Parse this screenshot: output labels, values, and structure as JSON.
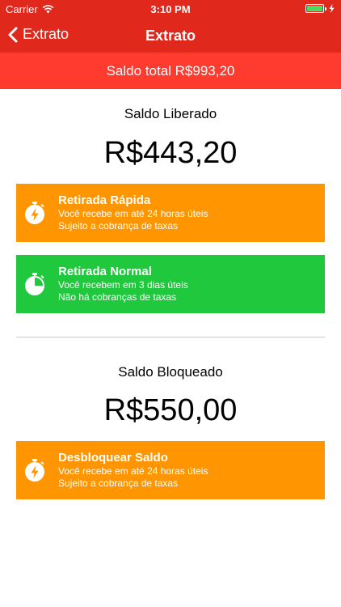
{
  "status_bar": {
    "carrier": "Carrier",
    "time": "3:10 PM"
  },
  "nav": {
    "back_label": "Extrato",
    "title": "Extrato"
  },
  "total": {
    "text": "Saldo total R$993,20"
  },
  "released": {
    "label": "Saldo Liberado",
    "amount": "R$443,20",
    "actions": [
      {
        "title": "Retirada Rápida",
        "line1": "Você recebe em até 24 horas úteis",
        "line2": "Sujeito a cobrança de taxas",
        "icon": "stopwatch-bolt-icon",
        "color": "#ff9500"
      },
      {
        "title": "Retirada Normal",
        "line1": "Você recebem em 3 dias úteis",
        "line2": "Não há cobranças de taxas",
        "icon": "stopwatch-icon",
        "color": "#1fc83c"
      }
    ]
  },
  "blocked": {
    "label": "Saldo Bloqueado",
    "amount": "R$550,00",
    "actions": [
      {
        "title": "Desbloquear Saldo",
        "line1": "Você recebe em até 24 horas úteis",
        "line2": "Sujeito a cobrança de taxas",
        "icon": "stopwatch-bolt-icon",
        "color": "#ff9500"
      }
    ]
  },
  "colors": {
    "nav_red": "#e0291c",
    "total_red": "#ff3b30",
    "orange": "#ff9500",
    "green": "#1fc83c",
    "battery_green": "#4cd964"
  }
}
